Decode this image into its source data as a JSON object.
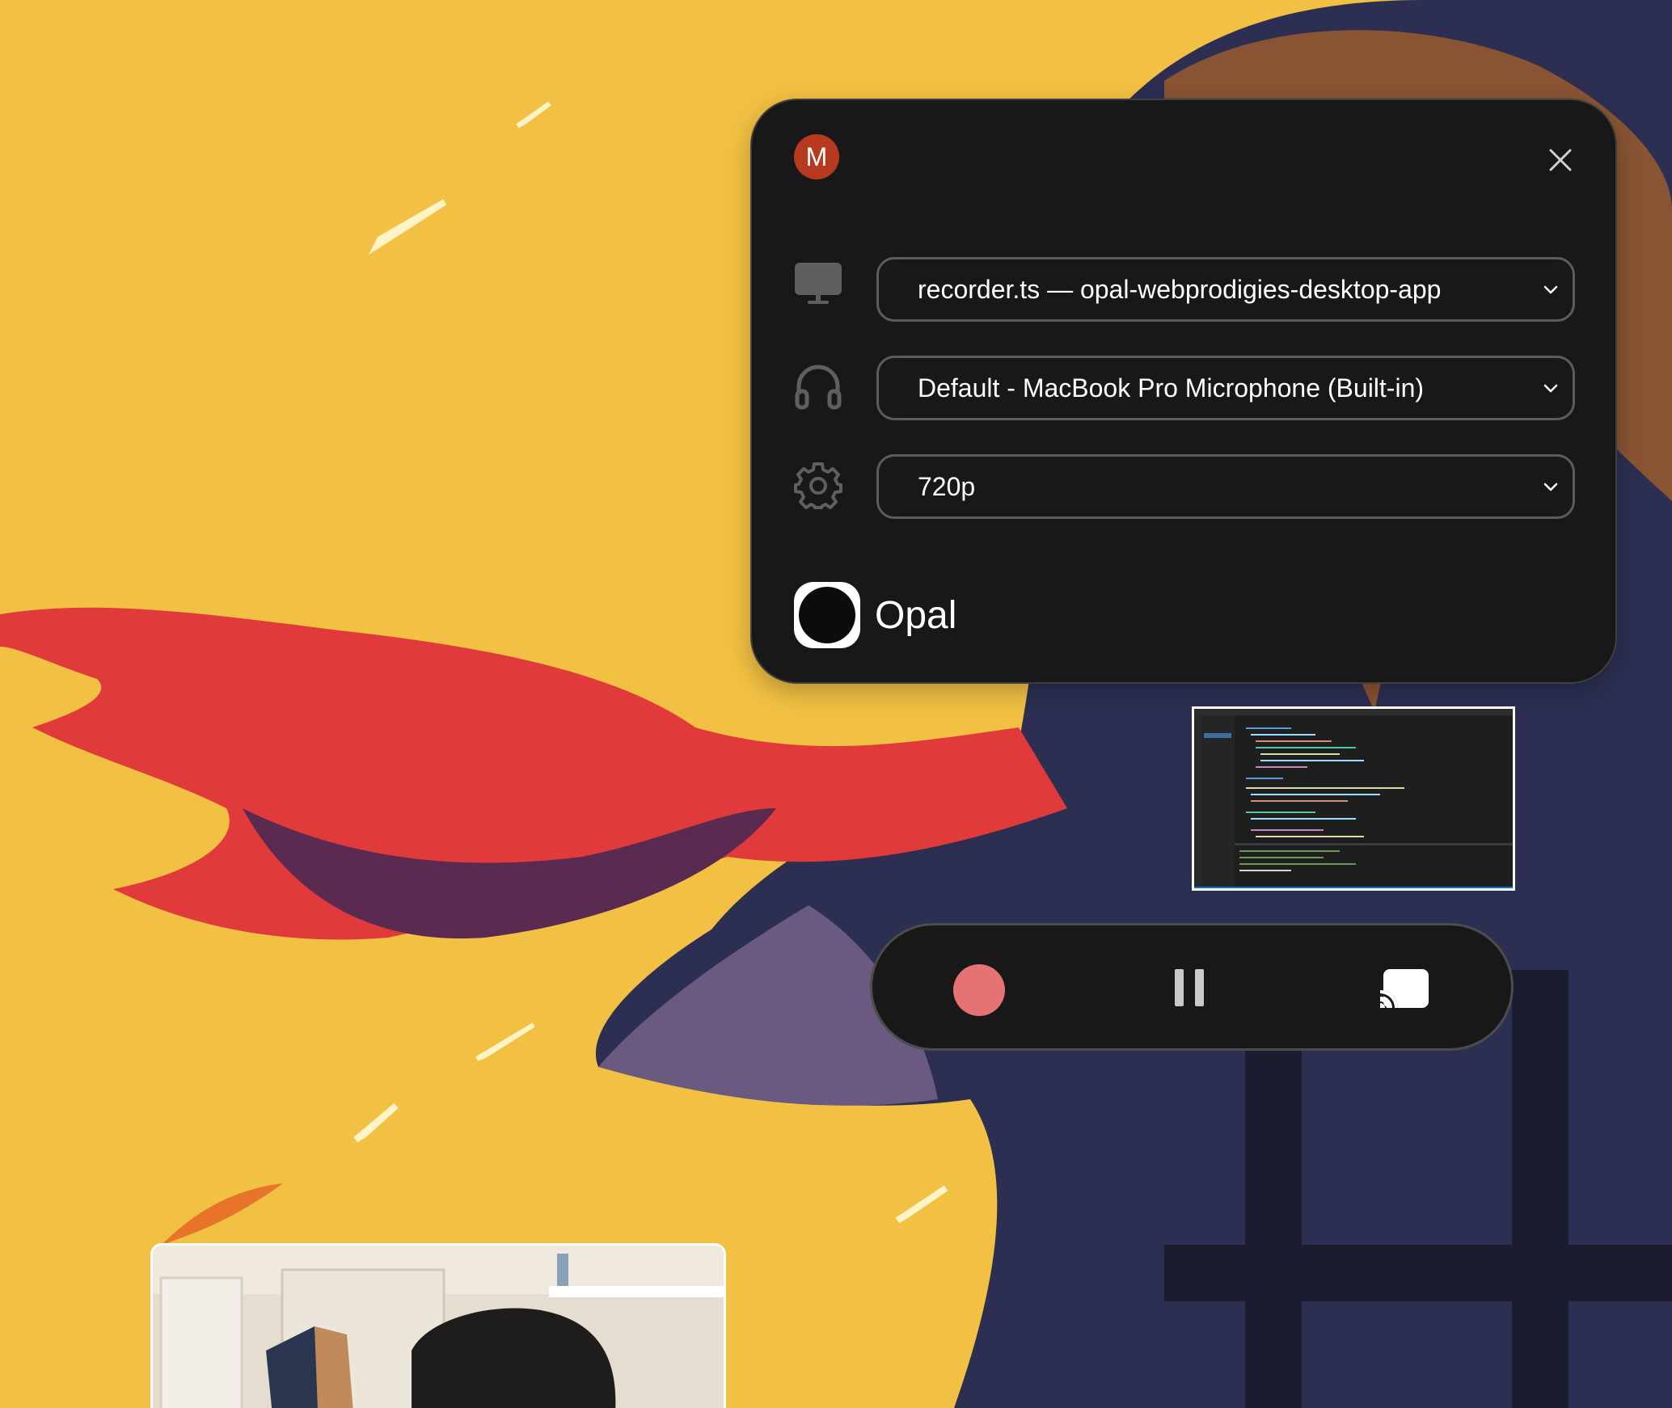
{
  "panel": {
    "avatar_initial": "M",
    "close_icon": "close-icon",
    "source": {
      "icon": "monitor-icon",
      "value": "recorder.ts — opal-webprodigies-desktop-app"
    },
    "audio": {
      "icon": "headphones-icon",
      "value": "Default - MacBook Pro Microphone (Built-in)"
    },
    "quality": {
      "icon": "gear-icon",
      "value": "720p"
    },
    "brand": {
      "name": "Opal"
    }
  },
  "controls": {
    "record": {
      "icon": "record-icon",
      "color": "#e57373"
    },
    "pause": {
      "icon": "pause-icon"
    },
    "cast": {
      "icon": "cast-icon"
    }
  },
  "colors": {
    "wallpaper": "#f2c143",
    "panel_bg": "#181818",
    "avatar_bg": "#b53a1f",
    "scarf": "#e03a3a"
  }
}
